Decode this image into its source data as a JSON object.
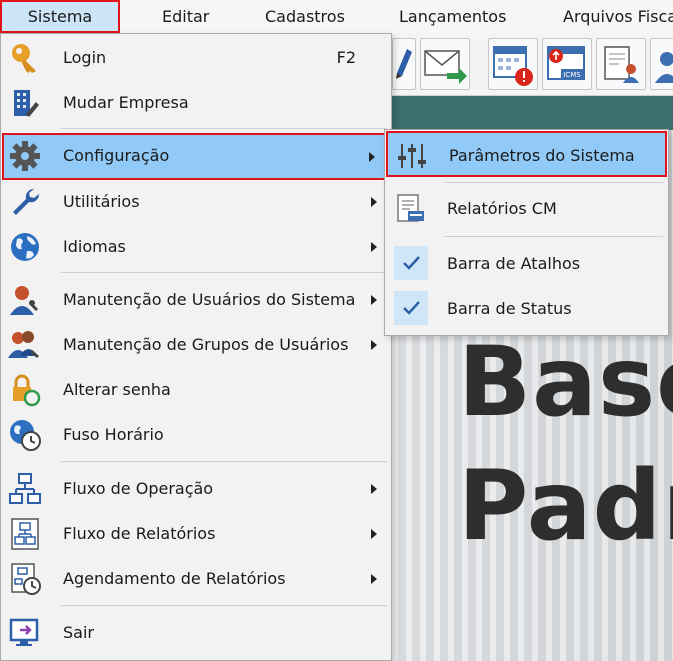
{
  "menubar": {
    "items": [
      "Sistema",
      "Editar",
      "Cadastros",
      "Lançamentos",
      "Arquivos Fisca"
    ]
  },
  "toolbar": {
    "buttons": [
      "pen-icon",
      "email-send-icon",
      "calendar-alert-icon",
      "icms-calendar-icon",
      "user-document-icon",
      "user-icon"
    ],
    "icms_label": "ICMS"
  },
  "background": {
    "line1": "Base",
    "line2": "Padra"
  },
  "menu": {
    "items": [
      {
        "label": "Login",
        "shortcut": "F2",
        "icon": "key-icon"
      },
      {
        "label": "Mudar Empresa",
        "icon": "building-icon"
      },
      {
        "label": "Configuração",
        "icon": "gear-icon",
        "submenu": true
      },
      {
        "label": "Utilitários",
        "icon": "wrench-icon",
        "submenu": true
      },
      {
        "label": "Idiomas",
        "icon": "globe-icon",
        "submenu": true
      },
      {
        "label": "Manutenção de Usuários do Sistema",
        "icon": "user-wrench-icon",
        "submenu": true
      },
      {
        "label": "Manutenção de Grupos de Usuários",
        "icon": "users-wrench-icon",
        "submenu": true
      },
      {
        "label": "Alterar senha",
        "icon": "lock-refresh-icon"
      },
      {
        "label": "Fuso Horário",
        "icon": "globe-clock-icon"
      },
      {
        "label": "Fluxo de Operação",
        "icon": "flowchart-icon",
        "submenu": true
      },
      {
        "label": "Fluxo de Relatórios",
        "icon": "report-flow-icon",
        "submenu": true
      },
      {
        "label": "Agendamento de Relatórios",
        "icon": "report-schedule-icon",
        "submenu": true
      },
      {
        "label": "Sair",
        "icon": "exit-icon"
      }
    ]
  },
  "submenu": {
    "items": [
      {
        "label": "Parâmetros do Sistema",
        "icon": "sliders-icon"
      },
      {
        "label": "Relatórios CM",
        "icon": "report-icon"
      },
      {
        "label": "Barra de Atalhos",
        "icon": "check-icon",
        "checked": true
      },
      {
        "label": "Barra de Status",
        "icon": "check-icon",
        "checked": true
      }
    ]
  },
  "colors": {
    "highlight": "#91c9f7",
    "focus_border": "#e0141e",
    "menu_bg": "#f2f2f2",
    "band": "#3a6f6d"
  }
}
